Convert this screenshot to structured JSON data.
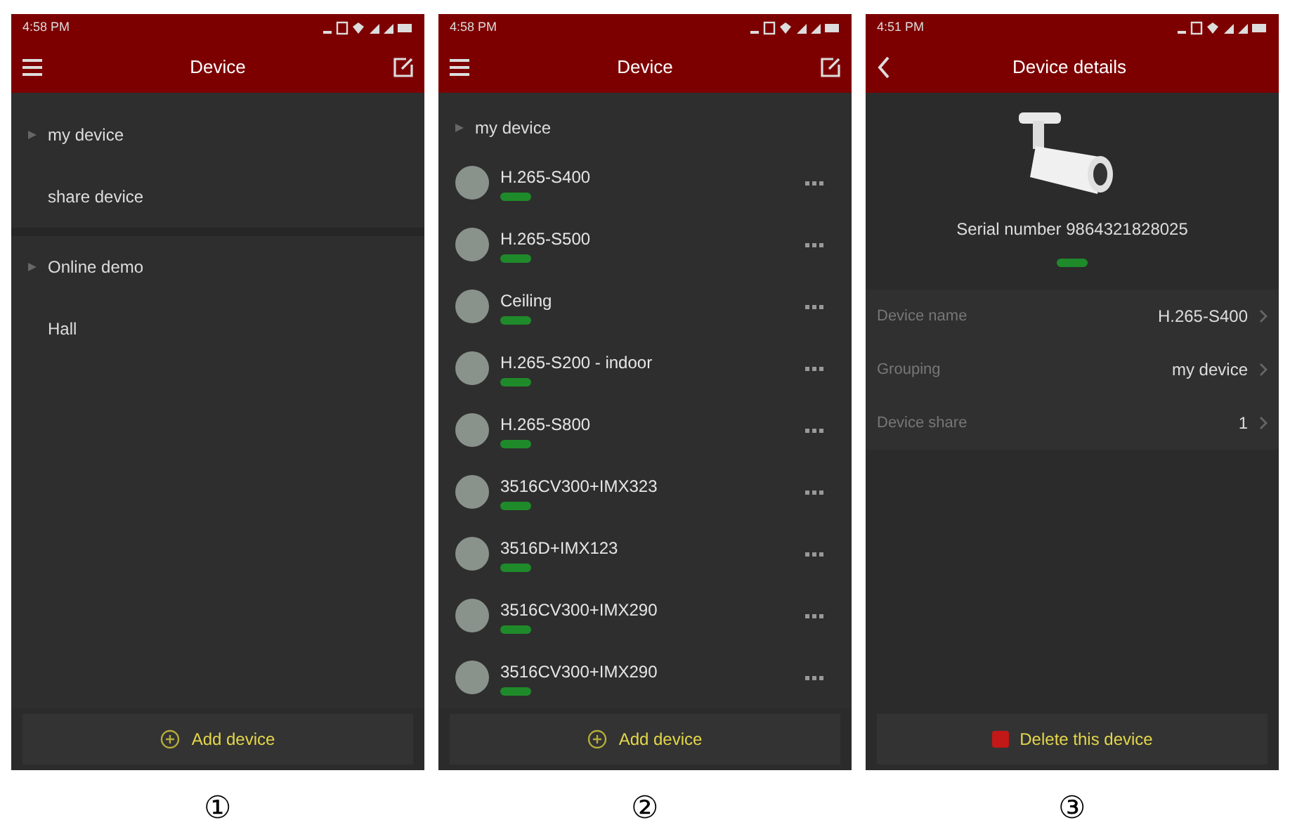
{
  "screens": [
    {
      "kind": "groups",
      "time": "4:58 PM",
      "title": "Device",
      "nav": {
        "kind": "menu"
      },
      "sections": [
        {
          "rows": [
            {
              "kind": "group",
              "label": "my device"
            },
            {
              "kind": "item",
              "label": "share device"
            }
          ]
        },
        {
          "rows": [
            {
              "kind": "group",
              "label": "Online demo"
            },
            {
              "kind": "item",
              "label": "Hall"
            }
          ]
        }
      ],
      "footer": {
        "kind": "add",
        "label": "Add device"
      },
      "caption": "①"
    },
    {
      "kind": "devices",
      "time": "4:58 PM",
      "title": "Device",
      "nav": {
        "kind": "menu"
      },
      "group": "my device",
      "devices": [
        {
          "name": "H.265-S400",
          "online": true
        },
        {
          "name": "H.265-S500",
          "online": true
        },
        {
          "name": "Ceiling",
          "online": true
        },
        {
          "name": "H.265-S200 - indoor",
          "online": true
        },
        {
          "name": "H.265-S800",
          "online": true
        },
        {
          "name": "3516CV300+IMX323",
          "online": true
        },
        {
          "name": "3516D+IMX123",
          "online": true
        },
        {
          "name": "3516CV300+IMX290",
          "online": true
        },
        {
          "name": "3516CV300+IMX290",
          "online": true
        }
      ],
      "footer": {
        "kind": "add",
        "label": "Add device"
      },
      "caption": "②"
    },
    {
      "kind": "details",
      "time": "4:51 PM",
      "title": "Device details",
      "nav": {
        "kind": "back"
      },
      "serial": "Serial number 9864321828025",
      "online": true,
      "fields": [
        {
          "label": "Device name",
          "value": "H.265-S400"
        },
        {
          "label": "Grouping",
          "value": "my device"
        },
        {
          "label": "Device share",
          "value": "1"
        }
      ],
      "footer": {
        "kind": "delete",
        "label": "Delete this device"
      },
      "caption": "③"
    }
  ]
}
